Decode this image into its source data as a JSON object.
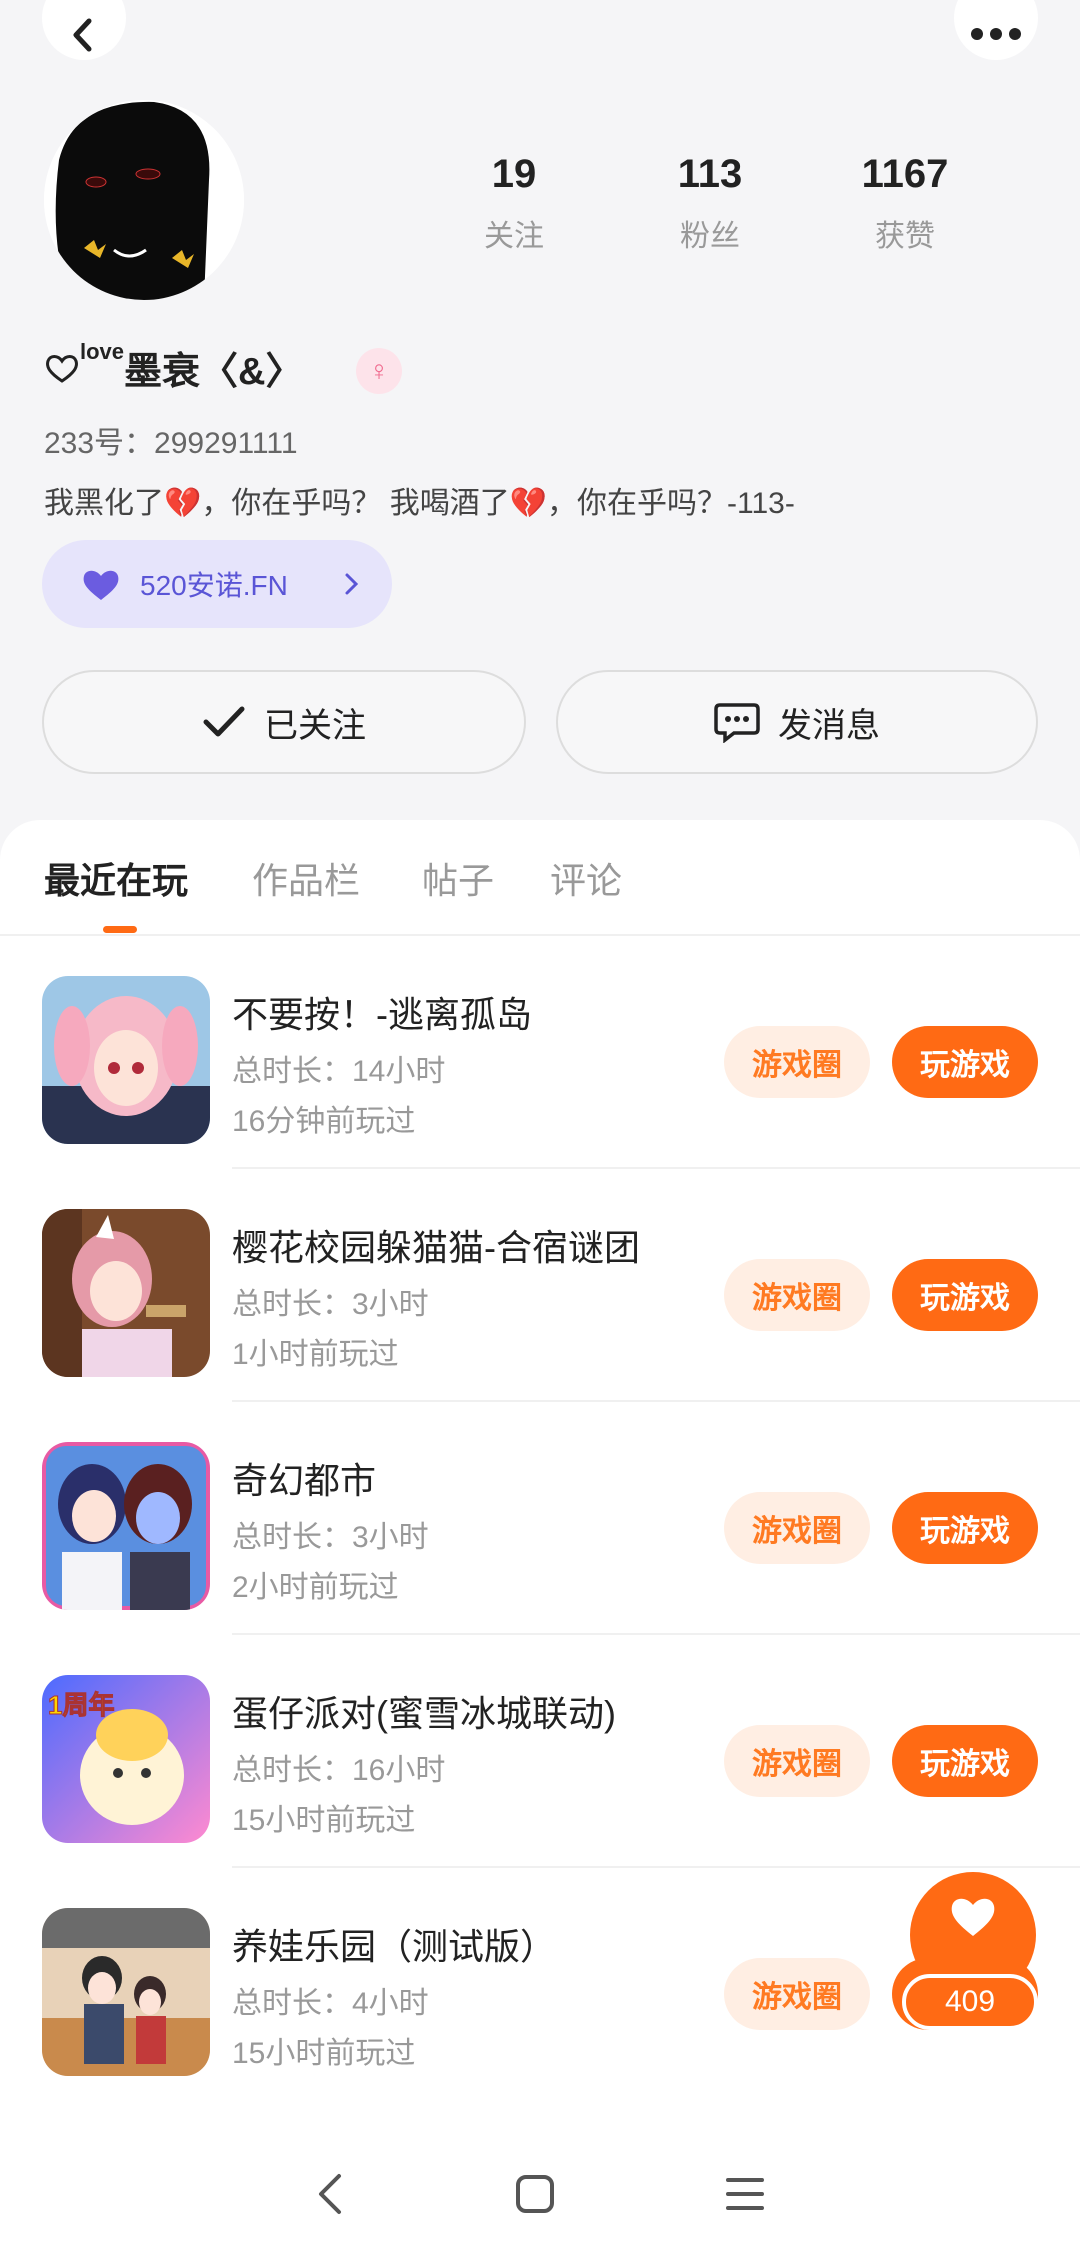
{
  "profile": {
    "nickname_prefix": "love",
    "nickname": "墨衰〈&〉",
    "gender": "female",
    "uid": "233号：299291111",
    "bio": "我黑化了💔，你在乎吗？ 我喝酒了💔，你在乎吗？-113-",
    "fan_tag": "520安诺.FN"
  },
  "stats": {
    "following": {
      "value": "19",
      "label": "关注"
    },
    "fans": {
      "value": "113",
      "label": "粉丝"
    },
    "likes": {
      "value": "1167",
      "label": "获赞"
    }
  },
  "actions": {
    "follow_label": "已关注",
    "message_label": "发消息"
  },
  "tabs": [
    {
      "label": "最近在玩",
      "active": true
    },
    {
      "label": "作品栏"
    },
    {
      "label": "帖子"
    },
    {
      "label": "评论"
    }
  ],
  "games": [
    {
      "title": "不要按！-逃离孤岛",
      "duration": "总时长：14小时",
      "last_played": "16分钟前玩过",
      "circle_label": "游戏圈",
      "play_label": "玩游戏",
      "icon": "anime-girl-pink-hair-icon"
    },
    {
      "title": "樱花校园躲猫猫-合宿谜团",
      "duration": "总时长：3小时",
      "last_played": "1小时前玩过",
      "circle_label": "游戏圈",
      "play_label": "玩游戏",
      "icon": "anime-girl-gun-icon"
    },
    {
      "title": "奇幻都市",
      "duration": "总时长：3小时",
      "last_played": "2小时前玩过",
      "circle_label": "游戏圈",
      "play_label": "玩游戏",
      "icon": "anime-duo-icon"
    },
    {
      "title": "蛋仔派对(蜜雪冰城联动)",
      "duration": "总时长：16小时",
      "last_played": "15小时前玩过",
      "circle_label": "游戏圈",
      "play_label": "玩游戏",
      "icon": "egg-party-icon",
      "icon_badge": "1周年"
    },
    {
      "title": "养娃乐园（测试版）",
      "duration": "总时长：4小时",
      "last_played": "15小时前玩过",
      "circle_label": "游戏圈",
      "play_label": "玩游戏",
      "icon": "family-game-icon"
    }
  ],
  "like_fab": {
    "count": "409"
  },
  "colors": {
    "accent": "#ff6a14",
    "accent_light": "#ffeee3",
    "tag_bg": "#e6e4fb",
    "tag_text": "#5a55d6"
  }
}
